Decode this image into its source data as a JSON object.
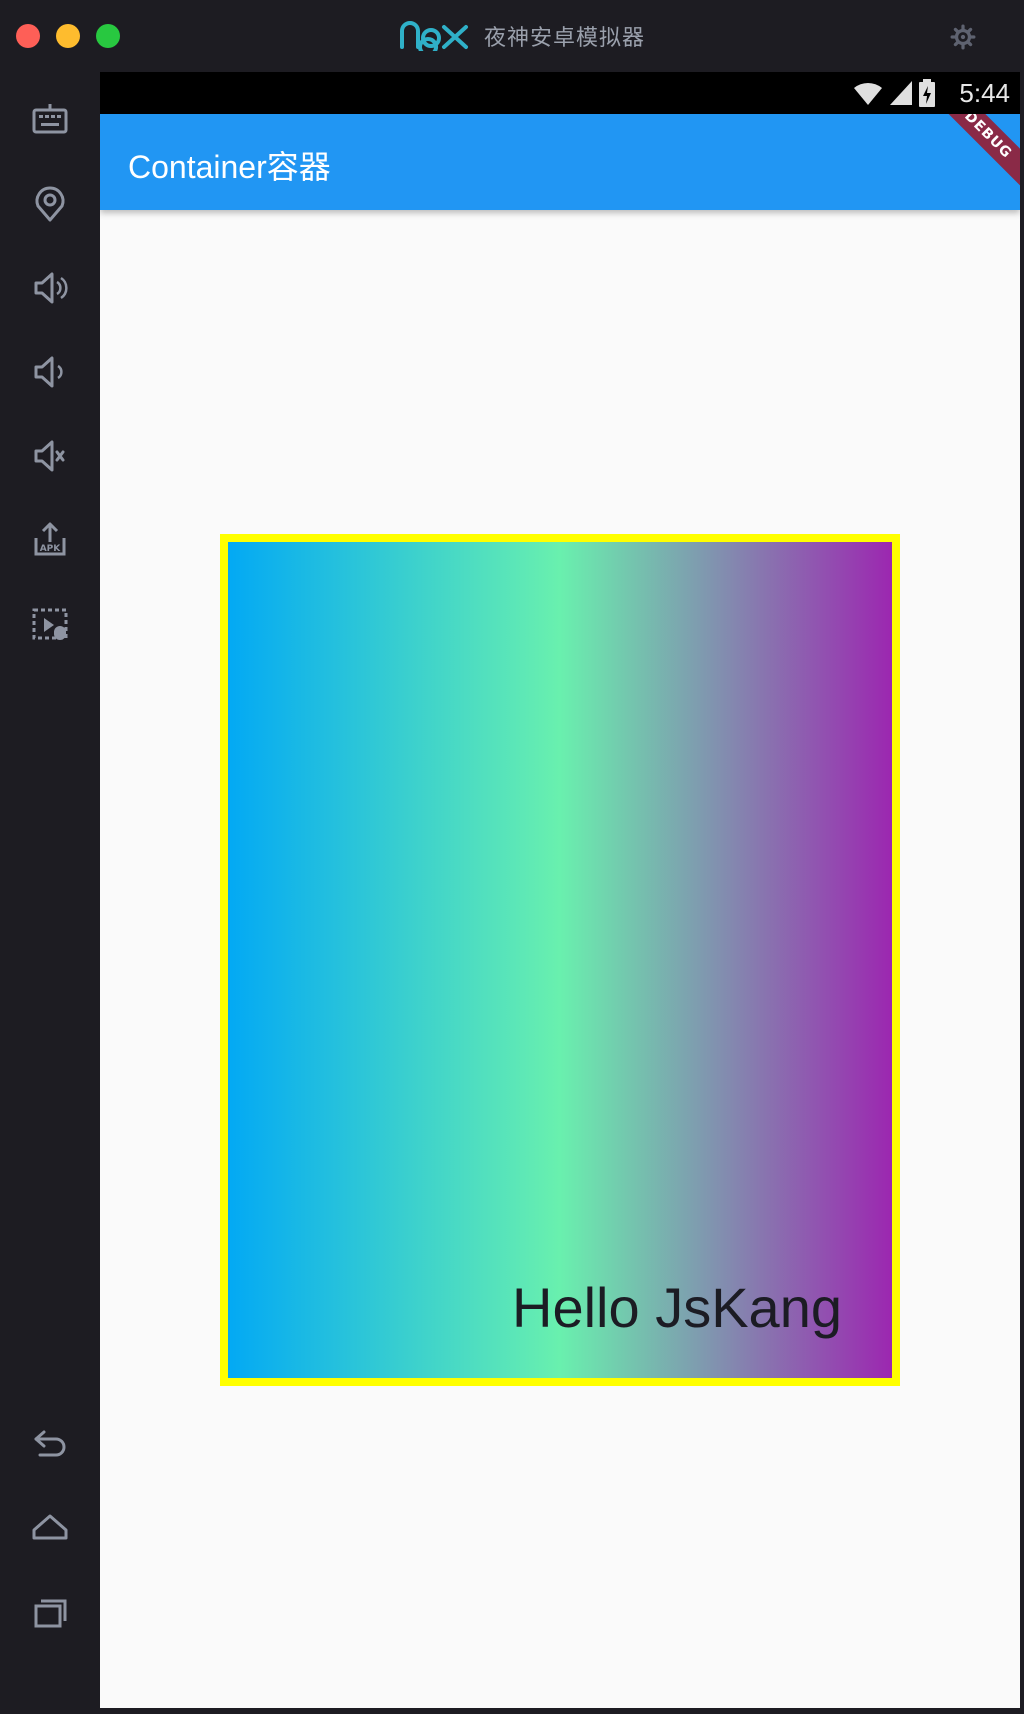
{
  "window": {
    "brand_logo": "nox-logo",
    "brand_name": "夜神安卓模拟器"
  },
  "sidebar": {
    "top_items": [
      {
        "name": "keyboard-icon"
      },
      {
        "name": "location-icon"
      },
      {
        "name": "volume-up-icon"
      },
      {
        "name": "volume-down-icon"
      },
      {
        "name": "mute-icon"
      },
      {
        "name": "apk-install-icon"
      },
      {
        "name": "macro-record-icon"
      }
    ],
    "bottom_items": [
      {
        "name": "back-icon"
      },
      {
        "name": "home-icon"
      },
      {
        "name": "recent-apps-icon"
      }
    ]
  },
  "status_bar": {
    "time": "5:44"
  },
  "app_bar": {
    "title": "Container容器",
    "debug_banner": "DEBUG",
    "color": "#2196f3"
  },
  "container": {
    "text": "Hello JsKang",
    "border_color": "#ffff00",
    "gradient": [
      "#03a9f4",
      "#69f0ae",
      "#9c27b0"
    ]
  }
}
